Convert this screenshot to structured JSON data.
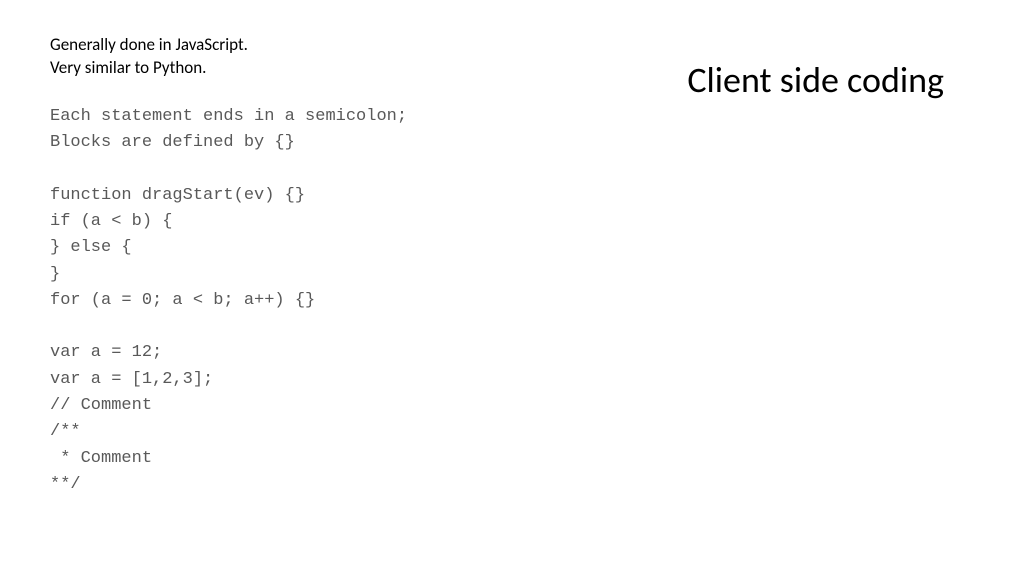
{
  "title": "Client side coding",
  "intro": {
    "line1": "Generally done in JavaScript.",
    "line2": "Very similar to Python."
  },
  "code": {
    "l01": "Each statement ends in a semicolon;",
    "l02": "Blocks are defined by {}",
    "l03": "function dragStart(ev) {}",
    "l04": "if (a < b) {",
    "l05": "} else {",
    "l06": "}",
    "l07": "for (a = 0; a < b; a++) {}",
    "l08": "var a = 12;",
    "l09": "var a = [1,2,3];",
    "l10": "// Comment",
    "l11": "/**",
    "l12": " * Comment",
    "l13": "**/"
  }
}
